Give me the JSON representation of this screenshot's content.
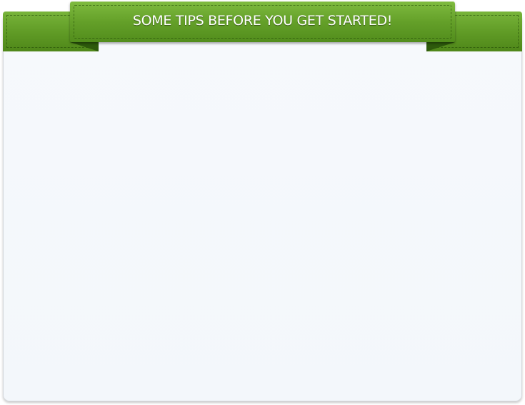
{
  "banner": {
    "title": "SOME TIPS BEFORE YOU GET STARTED!"
  },
  "colors": {
    "ribbon": "#64a029",
    "panel": "#f4f8fb"
  }
}
